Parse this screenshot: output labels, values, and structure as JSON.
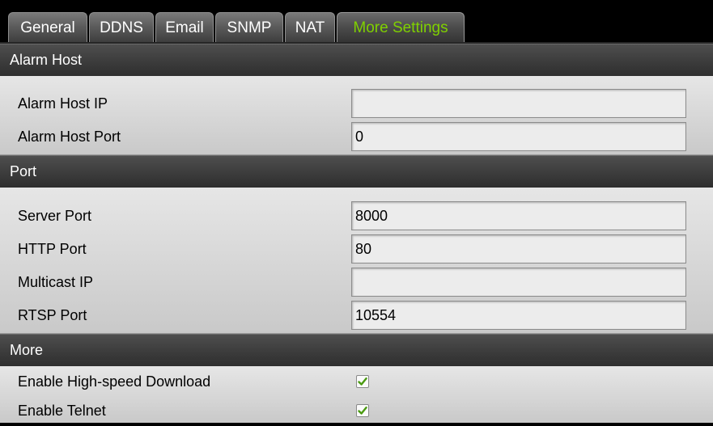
{
  "tabs": [
    {
      "label": "General"
    },
    {
      "label": "DDNS"
    },
    {
      "label": "Email"
    },
    {
      "label": "SNMP"
    },
    {
      "label": "NAT"
    },
    {
      "label": "More Settings",
      "active": true
    }
  ],
  "sections": {
    "alarm_host": {
      "title": "Alarm Host",
      "fields": [
        {
          "label": "Alarm Host IP",
          "value": ""
        },
        {
          "label": "Alarm Host Port",
          "value": "0"
        }
      ]
    },
    "port": {
      "title": "Port",
      "fields": [
        {
          "label": "Server Port",
          "value": "8000"
        },
        {
          "label": "HTTP Port",
          "value": "80"
        },
        {
          "label": "Multicast IP",
          "value": ""
        },
        {
          "label": "RTSP Port",
          "value": "10554"
        }
      ]
    },
    "more": {
      "title": "More",
      "options": [
        {
          "label": "Enable High-speed Download",
          "checked": true
        },
        {
          "label": "Enable Telnet",
          "checked": true
        }
      ]
    }
  },
  "colors": {
    "active_tab_text": "#7fd000",
    "checkmark": "#4a9a10"
  }
}
